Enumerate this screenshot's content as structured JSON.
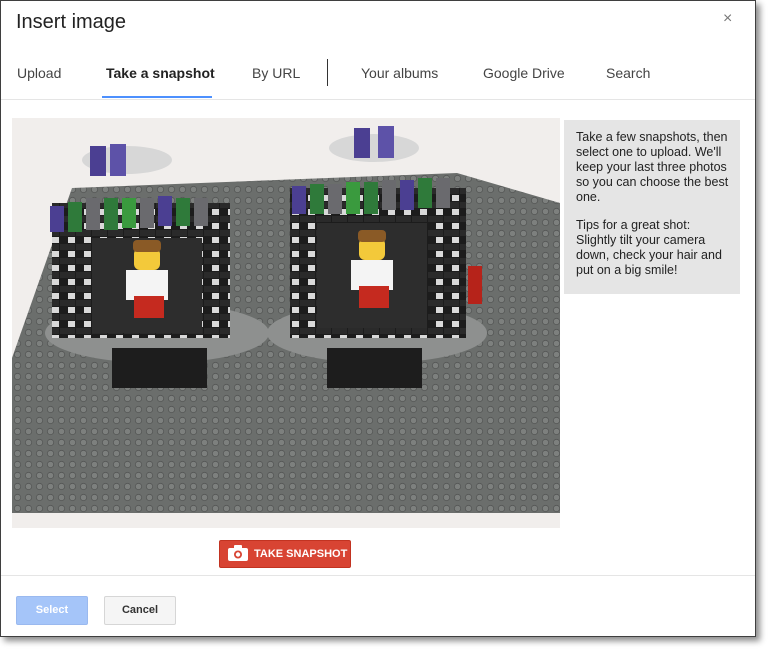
{
  "dialog": {
    "title": "Insert image",
    "close_glyph": "×"
  },
  "tabs": [
    {
      "label": "Upload"
    },
    {
      "label": "Take a snapshot"
    },
    {
      "label": "By URL"
    },
    {
      "label": "Your albums"
    },
    {
      "label": "Google Drive"
    },
    {
      "label": "Search"
    }
  ],
  "tips": {
    "para1": "Take a few snapshots, then select one to upload. We'll keep your last three photos so you can choose the best one.",
    "para2": "Tips for a great shot: Slightly tilt your camera down, check your hair and put on a big smile!"
  },
  "snapshot_button": {
    "label": "TAKE SNAPSHOT",
    "icon": "camera-icon"
  },
  "footer": {
    "select_label": "Select",
    "cancel_label": "Cancel"
  },
  "colors": {
    "accent": "#4d90fe",
    "snapshot_red": "#d84433",
    "select_disabled": "#a5c5f9"
  }
}
